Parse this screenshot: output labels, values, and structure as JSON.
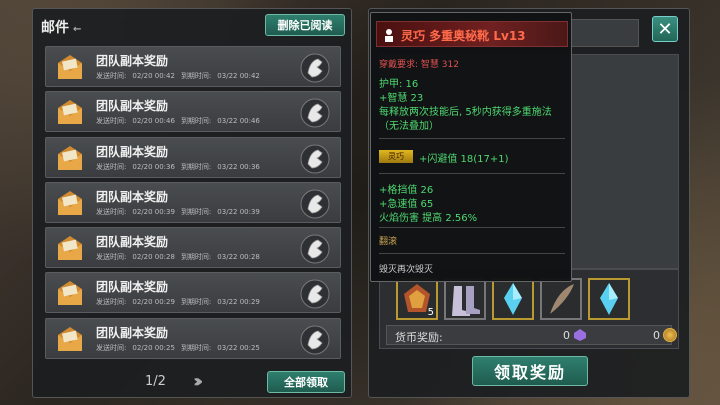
{
  "mail": {
    "title": "邮件",
    "delete_read": "删除已阅读",
    "items": [
      {
        "subject": "团队副本奖励",
        "sent_label": "发送时间:",
        "sent": "02/20 00:42",
        "expire_label": "到期时间:",
        "expire": "03/22 00:42"
      },
      {
        "subject": "团队副本奖励",
        "sent_label": "发送时间:",
        "sent": "02/20 00:46",
        "expire_label": "到期时间:",
        "expire": "03/22 00:46"
      },
      {
        "subject": "团队副本奖励",
        "sent_label": "发送时间:",
        "sent": "02/20 00:36",
        "expire_label": "到期时间:",
        "expire": "03/22 00:36"
      },
      {
        "subject": "团队副本奖励",
        "sent_label": "发送时间:",
        "sent": "02/20 00:39",
        "expire_label": "到期时间:",
        "expire": "03/22 00:39"
      },
      {
        "subject": "团队副本奖励",
        "sent_label": "发送时间:",
        "sent": "02/20 00:28",
        "expire_label": "到期时间:",
        "expire": "03/22 00:28"
      },
      {
        "subject": "团队副本奖励",
        "sent_label": "发送时间:",
        "sent": "02/20 00:29",
        "expire_label": "到期时间:",
        "expire": "03/22 00:29"
      },
      {
        "subject": "团队副本奖励",
        "sent_label": "发送时间:",
        "sent": "02/20 00:25",
        "expire_label": "到期时间:",
        "expire": "03/22 00:25"
      }
    ],
    "page": "1/2",
    "claim_all": "全部领取"
  },
  "detail": {
    "close": "✕",
    "rewards": {
      "slot1_count": "5",
      "currency_label": "货币奖励:",
      "currency1": "0",
      "currency2": "0"
    },
    "claim": "领取奖励"
  },
  "tooltip": {
    "name": "灵巧  多重奥秘靴  Lv13",
    "requirement": "穿戴要求:  智慧 312",
    "armor": "护甲:  16",
    "wisdom": "+智慧 23",
    "effect1": "每释放两次技能后, 5秒内获得多重施法",
    "effect2": "（无法叠加）",
    "tag": "灵巧",
    "dodge": "+闪避值 18(17+1)",
    "block": "+格挡值 26",
    "haste": "+急速值 65",
    "fire": "火焰伤害 提高 2.56%",
    "roll": "翻滚",
    "flavor": "毁灭再次毁灭"
  },
  "colors": {
    "accent": "#2f7f6f",
    "rarity": "#ff6a4a",
    "stat": "#4fd870"
  }
}
